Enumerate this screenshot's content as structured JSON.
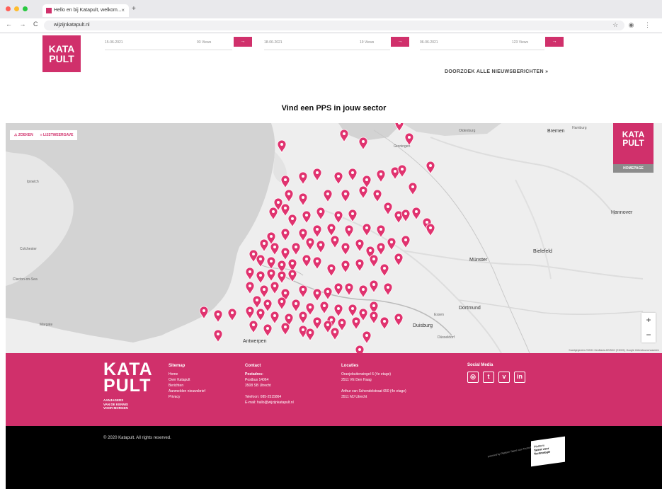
{
  "browser": {
    "tab_title": "Hello en bij Katapult, welkom...",
    "tab_close": "×",
    "new_tab": "+",
    "url": "wijzijnkatapult.nl",
    "nav_glyphs": "← → C",
    "toolbar_glyphs": "☆ ◉ ⋮"
  },
  "logo": {
    "line1": "KATA",
    "line2": "PULT"
  },
  "news": [
    {
      "date": "15-06-2021",
      "views": "93 Views",
      "btn": "→"
    },
    {
      "date": "18-06-2021",
      "views": "19 Views",
      "btn": "→"
    },
    {
      "date": "06-06-2021",
      "views": "123 Views",
      "btn": "→"
    }
  ],
  "all_news_label": "DOORZOEK ALLE NIEUWSBERICHTEN »",
  "map_section_title": "Vind een PPS in jouw sector",
  "map": {
    "filter_label": "ZOEKEN",
    "list_label": "LIJSTWEERGAVE",
    "logo_line1": "KATA",
    "logo_line2": "PULT",
    "logo_sub": "HOMEPAGE",
    "zoom_in": "+",
    "zoom_out": "−",
    "attribution": "Kaartgegevens ©2021 GeoBasis-DE/BKG (©2009), Google  Gebruiksvoorwaarden",
    "labels": [
      {
        "text": "Bremen"
      },
      {
        "text": "Hamburg"
      },
      {
        "text": "Hannover"
      },
      {
        "text": "Münster"
      },
      {
        "text": "Bielefeld"
      },
      {
        "text": "Dortmund"
      },
      {
        "text": "Essen"
      },
      {
        "text": "Duisburg"
      },
      {
        "text": "Düsseldorf"
      },
      {
        "text": "Antwerpen"
      },
      {
        "text": "Oldenburg"
      },
      {
        "text": "Groningen"
      },
      {
        "text": "Ipswich"
      },
      {
        "text": "Colchester"
      },
      {
        "text": "Margate"
      },
      {
        "text": "Clacton-on-Sea"
      }
    ]
  },
  "footer": {
    "logo_line1": "KATA",
    "logo_line2": "PULT",
    "tagline": [
      "AANJAGERS",
      "VAN DE KENNIS",
      "VOOR MORGEN"
    ],
    "sitemap": {
      "heading": "Sitemap",
      "items": [
        "Home",
        "Over Katapult",
        "Berichten",
        "Aanmelden nieuwsbrief",
        "Privacy"
      ]
    },
    "contact": {
      "heading": "Contact",
      "items": [
        "Postadres:",
        "Postbus 14064",
        "3508 SB Utrecht",
        "",
        "Telefoon: 085-2515864",
        "E-mail: hallo@wijzijnkatapult.nl"
      ]
    },
    "locaties": {
      "heading": "Locaties",
      "items": [
        "Oranjebuitensingel 6 (4e etage)",
        "2511 VE Den Haag",
        "",
        "Arthur van Schendelstraat 650 (4e etage)",
        "3511 MJ Utrecht"
      ]
    },
    "social": {
      "heading": "Social Media",
      "icons": [
        "◎",
        "t",
        "v",
        "in"
      ]
    }
  },
  "bottom": {
    "copyright": "© 2020 Katapult. All rights reserved.",
    "powered": "powered by Platform Talent voor Technologie",
    "badge_lines": [
      "Platform",
      "Talent voor",
      "Technologie"
    ]
  }
}
